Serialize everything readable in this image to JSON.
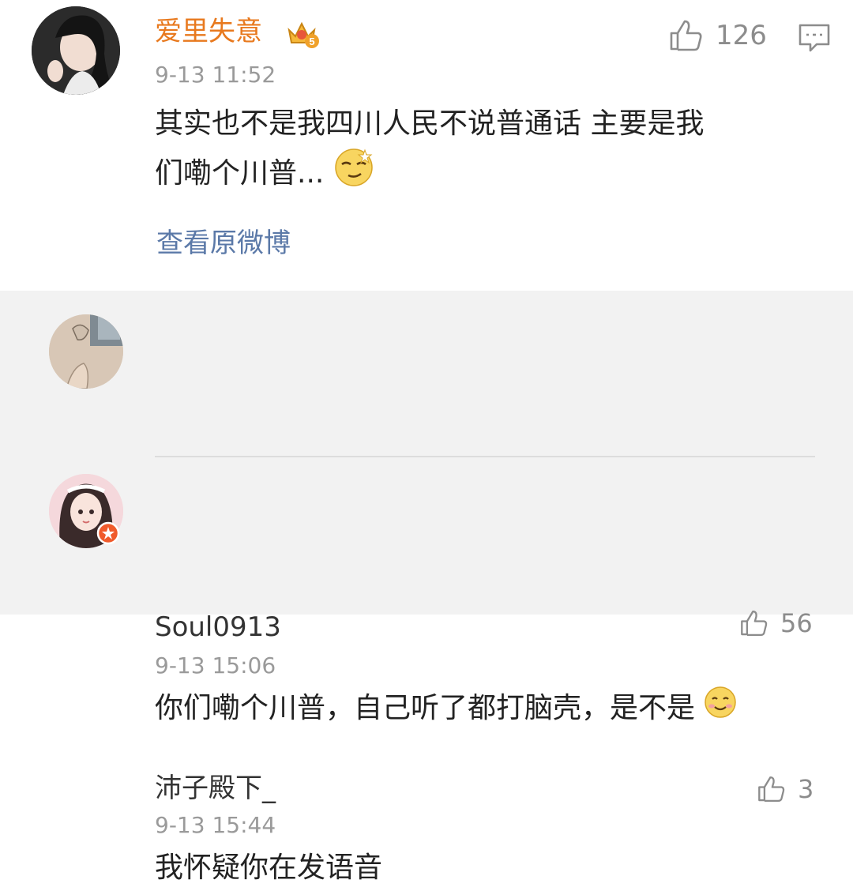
{
  "main_comment": {
    "username": "爱里失意",
    "timestamp": "9-13 11:52",
    "likes": "126",
    "text_line1": "其实也不是我四川人民不说普通话 主要是我",
    "text_line2": "们嘞个川普...",
    "view_original": "查看原微博",
    "badge_icon": "crown-badge-icon",
    "badge_level": "5"
  },
  "replies": [
    {
      "username": "Soul0913",
      "timestamp": "9-13 15:06",
      "likes": "56",
      "text": "你们嘞个川普，自己听了都打脑壳，是不是"
    },
    {
      "username": "沛子殿下_",
      "timestamp": "9-13 15:44",
      "likes": "3",
      "text": "我怀疑你在发语音"
    }
  ],
  "colors": {
    "vip_name": "#e8791e",
    "link": "#5b79a8",
    "reply_bg": "#f2f2f2"
  }
}
